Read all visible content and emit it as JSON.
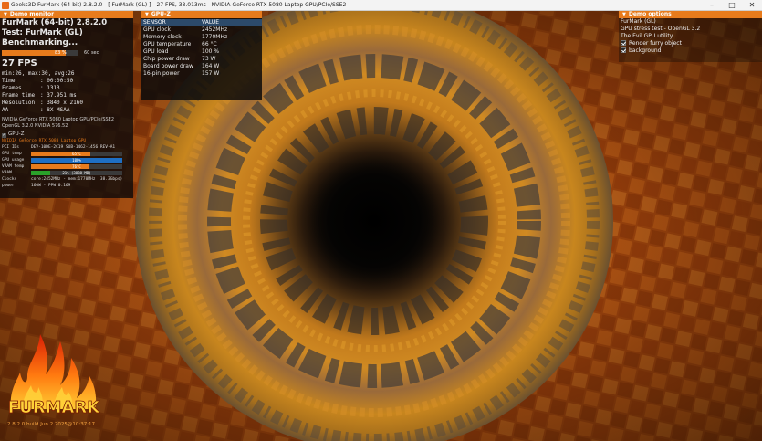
{
  "window": {
    "title": "Geeks3D FurMark (64-bit) 2.8.2.0 - [ FurMark (GL) ] - 27 FPS, 38.013ms - NVIDIA GeForce RTX 5080 Laptop GPU/PCIe/SSE2",
    "minimize": "–",
    "maximize": "□",
    "close": "✕"
  },
  "demo_monitor": {
    "header": "Demo monitor",
    "app_line": "FurMark (64-bit) 2.8.2.0",
    "test_line": "Test: FurMark (GL)",
    "status": "Benchmarking...",
    "progress": {
      "percent_text": "83 %",
      "fraction": 0.83,
      "duration": "60 sec"
    },
    "fps": "27 FPS",
    "fps_stats": "min:26, max:30, avg:26",
    "stats": [
      {
        "label": "Time",
        "value": ": 00:00:50"
      },
      {
        "label": "Frames",
        "value": ": 1313"
      },
      {
        "label": "Frame time",
        "value": ": 37.951 ms"
      },
      {
        "label": "Resolution",
        "value": ": 3840 x 2160"
      },
      {
        "label": "AA",
        "value": ": 8X MSAA"
      }
    ],
    "renderer": "NVIDIA GeForce RTX 5080 Laptop GPU/PCIe/SSE2",
    "gl_version": "OpenGL 3.2.0 NVIDIA 576.52",
    "gpuz_label": "GPU-Z",
    "gpu_name": "NVIDIA GeForce RTX 5080 Laptop GPU",
    "pci": {
      "label": "PCI IDs",
      "value": "DEV-10DE-2C19 SUB-1462-1456 REV-A1"
    },
    "bars": [
      {
        "label": "GPU temp",
        "text": "65°C",
        "fraction": 0.65,
        "color": "#e77b1c"
      },
      {
        "label": "GPU usage",
        "text": "100%",
        "fraction": 1.0,
        "color": "#1e6fc4"
      },
      {
        "label": "VRAM temp",
        "text": "76°C",
        "fraction": 0.64,
        "color": "#e77b1c"
      },
      {
        "label": "VRAM",
        "text": "21% (3888 MB)",
        "fraction": 0.21,
        "color": "#2aa02a"
      }
    ],
    "clocks": {
      "label": "Clocks",
      "value": "core:2452MHz - mem:1770MHz (38.3Gbps)"
    },
    "power": {
      "label": "power",
      "value": "160W - PPW:0.169"
    }
  },
  "gpuz": {
    "header": "GPU-Z",
    "col_sensor": "SENSOR",
    "col_value": "VALUE",
    "rows": [
      {
        "sensor": "GPU clock",
        "value": "2452MHz"
      },
      {
        "sensor": "Memory clock",
        "value": "1770MHz"
      },
      {
        "sensor": "GPU temperature",
        "value": "66 °C"
      },
      {
        "sensor": "GPU load",
        "value": "100 %"
      },
      {
        "sensor": "Chip power draw",
        "value": "73 W"
      },
      {
        "sensor": "Board power draw",
        "value": "164 W"
      },
      {
        "sensor": "16-pin power",
        "value": "157 W"
      }
    ]
  },
  "demo_options": {
    "header": "Demo options",
    "line1": "FurMark (GL)",
    "line2": "GPU stress test - OpenGL 3.2",
    "line3": "The Evil GPU utility",
    "checks": [
      {
        "label": "Render furry object",
        "checked": true
      },
      {
        "label": "background",
        "checked": true
      }
    ]
  },
  "logo": {
    "text": "FURMARK",
    "version": "2.8.2.0 build Jun 2 2025@10:37:17"
  }
}
